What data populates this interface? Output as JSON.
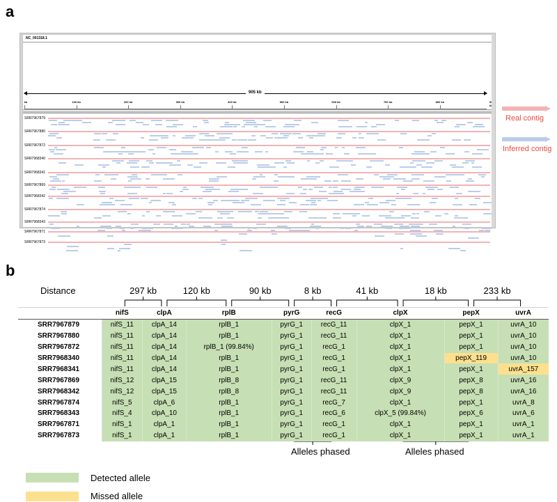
{
  "panel_a": {
    "letter": "a",
    "accession": "NC_001318.1",
    "scale_label": "905 kb",
    "ticks": [
      "kb",
      "100 kb",
      "200 kb",
      "300 kb",
      "400 kb",
      "500 kb",
      "600 kb",
      "700 kb",
      "800 kb",
      "900 kb"
    ],
    "samples": [
      "SRR7967879",
      "SRR7967880",
      "SRR7967872",
      "SRR7968340",
      "SRR7968341",
      "SRR7967869",
      "SRR7968342",
      "SRR7967874",
      "SRR7968343",
      "SRR7967871",
      "SRR7967873"
    ],
    "legend": [
      {
        "label": "Real contig",
        "color": "#f4b3b3"
      },
      {
        "label": "Inferred contig",
        "color": "#b9cde8"
      }
    ]
  },
  "panel_b": {
    "letter": "b",
    "distance_label": "Distance",
    "distances": [
      "297 kb",
      "120 kb",
      "90 kb",
      "8 kb",
      "41 kb",
      "18 kb",
      "233 kb"
    ],
    "genes": [
      "nifS",
      "clpA",
      "rplB",
      "pyrG",
      "recG",
      "clpX",
      "pepX",
      "uvrA"
    ],
    "rows": [
      {
        "sample": "SRR7967879",
        "alleles": [
          "nifS_11",
          "clpA_14",
          "rplB_1",
          "pyrG_1",
          "recG_11",
          "clpX_1",
          "pepX_1",
          "uvrA_10"
        ],
        "missed": []
      },
      {
        "sample": "SRR7967880",
        "alleles": [
          "nifS_11",
          "clpA_14",
          "rplB_1",
          "pyrG_1",
          "recG_11",
          "clpX_1",
          "pepX_1",
          "uvrA_10"
        ],
        "missed": []
      },
      {
        "sample": "SRR7967872",
        "alleles": [
          "nifS_11",
          "clpA_14",
          "rplB_1 (99.84%)",
          "pyrG_1",
          "recG_1",
          "clpX_1",
          "pepX_1",
          "uvrA_10"
        ],
        "missed": []
      },
      {
        "sample": "SRR7968340",
        "alleles": [
          "nifS_11",
          "clpA_14",
          "rplB_1",
          "pyrG_1",
          "recG_1",
          "clpX_1",
          "pepX_119",
          "uvrA_10"
        ],
        "missed": [
          6
        ]
      },
      {
        "sample": "SRR7968341",
        "alleles": [
          "nifS_11",
          "clpA_14",
          "rplB_1",
          "pyrG_1",
          "recG_1",
          "clpX_1",
          "pepX_1",
          "uvrA_157"
        ],
        "missed": [
          7
        ]
      },
      {
        "sample": "SRR7967869",
        "alleles": [
          "nifS_12",
          "clpA_15",
          "rplB_8",
          "pyrG_1",
          "recG_11",
          "clpX_9",
          "pepX_8",
          "uvrA_16"
        ],
        "missed": []
      },
      {
        "sample": "SRR7968342",
        "alleles": [
          "nifS_12",
          "clpA_15",
          "rplB_8",
          "pyrG_1",
          "recG_11",
          "clpX_9",
          "pepX_8",
          "uvrA_16"
        ],
        "missed": []
      },
      {
        "sample": "SRR7967874",
        "alleles": [
          "nifS_5",
          "clpA_6",
          "rplB_1",
          "pyrG_1",
          "recG_7",
          "clpX_1",
          "pepX_1",
          "uvrA_8"
        ],
        "missed": []
      },
      {
        "sample": "SRR7968343",
        "alleles": [
          "nifS_4",
          "clpA_10",
          "rplB_1",
          "pyrG_1",
          "recG_6",
          "clpX_5 (99.84%)",
          "pepX_6",
          "uvrA_6"
        ],
        "missed": []
      },
      {
        "sample": "SRR7967871",
        "alleles": [
          "nifS_1",
          "clpA_1",
          "rplB_1",
          "pyrG_1",
          "recG_1",
          "clpX_1",
          "pepX_1",
          "uvrA_1"
        ],
        "missed": []
      },
      {
        "sample": "SRR7967873",
        "alleles": [
          "nifS_1",
          "clpA_1",
          "rplB_1",
          "pyrG_1",
          "recG_1",
          "clpX_1",
          "pepX_1",
          "uvrA_1"
        ],
        "missed": []
      }
    ],
    "phased_label_1": "Alleles phased",
    "phased_label_2": "Alleles phased",
    "legend": [
      {
        "label": "Detected allele",
        "color": "#c7dfb4"
      },
      {
        "label": "Missed allele",
        "color": "#fce08d"
      }
    ]
  }
}
